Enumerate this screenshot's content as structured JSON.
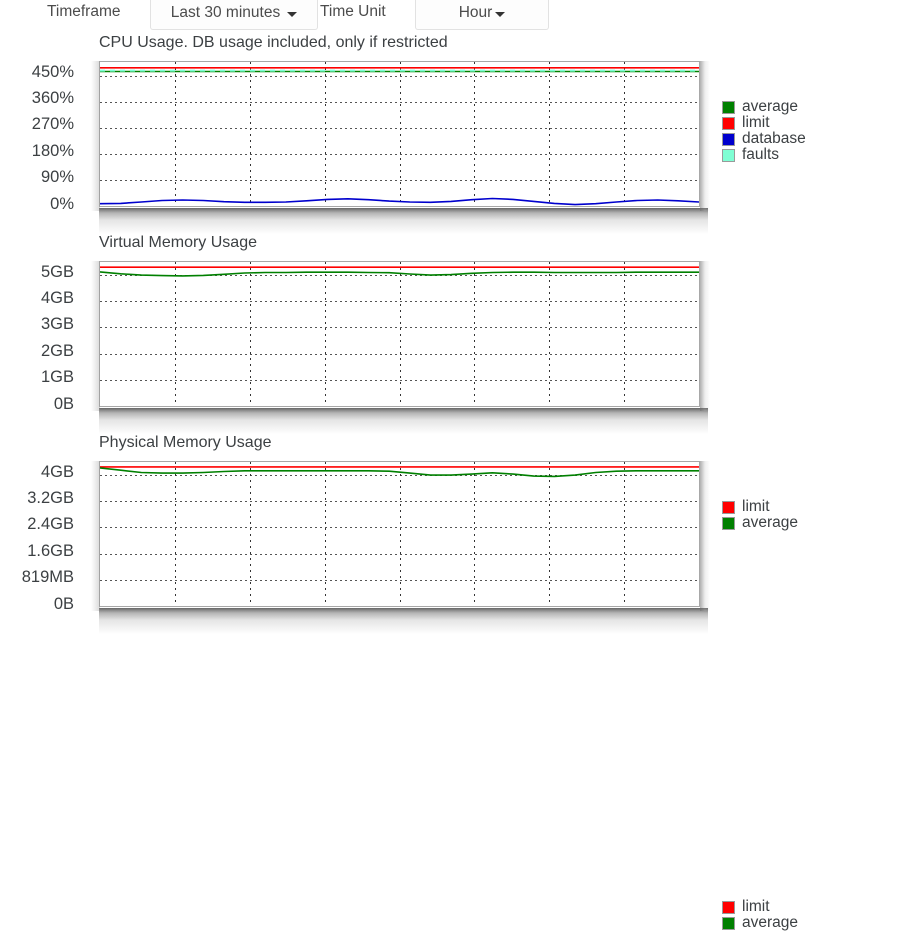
{
  "toolbar": {
    "timeframe_label": "Timeframe",
    "timeframe_value": "Last 30 minutes",
    "timeunit_label": "Time Unit",
    "timeunit_value": "Hour"
  },
  "colors": {
    "average": "#008000",
    "limit": "#ff0000",
    "database": "#0000cd",
    "faults": "#7fffd4",
    "grid": "#555555",
    "axis": "#a8a8a8",
    "text": "#3c4043"
  },
  "charts": [
    {
      "id": "cpu",
      "title": "CPU Usage. DB usage included, only if restricted",
      "yticks": [
        "450%",
        "360%",
        "270%",
        "180%",
        "90%",
        "0%"
      ],
      "legend": [
        {
          "label": "average",
          "color": "#008000"
        },
        {
          "label": "limit",
          "color": "#ff0000"
        },
        {
          "label": "database",
          "color": "#0000cd"
        },
        {
          "label": "faults",
          "color": "#7fffd4"
        }
      ]
    },
    {
      "id": "vmem",
      "title": "Virtual Memory Usage",
      "yticks": [
        "5GB",
        "4GB",
        "3GB",
        "2GB",
        "1GB",
        "0B"
      ],
      "legend": [
        {
          "label": "limit",
          "color": "#ff0000"
        },
        {
          "label": "average",
          "color": "#008000"
        }
      ]
    },
    {
      "id": "pmem",
      "title": "Physical Memory Usage",
      "yticks": [
        "4GB",
        "3.2GB",
        "2.4GB",
        "1.6GB",
        "819MB",
        "0B"
      ],
      "legend": [
        {
          "label": "limit",
          "color": "#ff0000"
        },
        {
          "label": "average",
          "color": "#008000"
        }
      ]
    }
  ],
  "chart_data": [
    {
      "type": "line",
      "title": "CPU Usage. DB usage included, only if restricted",
      "xlabel": "",
      "ylabel": "",
      "ylim": [
        0,
        500
      ],
      "ytick_values": [
        450,
        360,
        270,
        180,
        90,
        0
      ],
      "ytick_labels": [
        "450%",
        "360%",
        "270%",
        "180%",
        "90%",
        "0%"
      ],
      "grid": true,
      "legend_position": "right",
      "x": [
        0,
        1,
        2,
        3,
        4,
        5,
        6,
        7,
        8,
        9,
        10,
        11,
        12,
        13,
        14,
        15,
        16,
        17,
        18,
        19,
        20,
        21,
        22,
        23,
        24,
        25,
        26,
        27,
        28,
        29
      ],
      "series": [
        {
          "name": "limit",
          "color": "#ff0000",
          "values": [
            480,
            480,
            480,
            480,
            480,
            480,
            480,
            480,
            480,
            480,
            480,
            480,
            480,
            480,
            480,
            480,
            480,
            480,
            480,
            480,
            480,
            480,
            480,
            480,
            480,
            480,
            480,
            480,
            480,
            480
          ]
        },
        {
          "name": "average",
          "color": "#008000",
          "values": [
            467,
            467,
            467,
            467,
            467,
            467,
            467,
            467,
            467,
            467,
            467,
            467,
            467,
            467,
            467,
            467,
            467,
            467,
            467,
            467,
            467,
            467,
            467,
            467,
            467,
            467,
            467,
            467,
            467,
            467
          ]
        },
        {
          "name": "faults",
          "color": "#7fffd4",
          "values": [
            470,
            470,
            470,
            470,
            470,
            470,
            470,
            470,
            470,
            470,
            470,
            470,
            470,
            470,
            470,
            470,
            470,
            470,
            470,
            470,
            470,
            470,
            470,
            470,
            470,
            470,
            470,
            470,
            470,
            470
          ]
        },
        {
          "name": "database",
          "color": "#0000cd",
          "values": [
            8,
            9,
            14,
            19,
            21,
            19,
            15,
            13,
            13,
            14,
            18,
            23,
            25,
            22,
            17,
            14,
            13,
            16,
            22,
            26,
            23,
            16,
            9,
            5,
            8,
            14,
            19,
            21,
            18,
            14
          ]
        }
      ]
    },
    {
      "type": "line",
      "title": "Virtual Memory Usage",
      "xlabel": "",
      "ylabel": "",
      "ylim": [
        0,
        5.5
      ],
      "ytick_values": [
        5,
        4,
        3,
        2,
        1,
        0
      ],
      "ytick_labels": [
        "5GB",
        "4GB",
        "3GB",
        "2GB",
        "1GB",
        "0B"
      ],
      "grid": true,
      "legend_position": "right",
      "x": [
        0,
        1,
        2,
        3,
        4,
        5,
        6,
        7,
        8,
        9,
        10,
        11,
        12,
        13,
        14,
        15,
        16,
        17,
        18,
        19,
        20,
        21,
        22,
        23,
        24,
        25,
        26,
        27,
        28,
        29
      ],
      "series": [
        {
          "name": "limit",
          "color": "#ff0000",
          "values": [
            5.3,
            5.3,
            5.3,
            5.3,
            5.3,
            5.3,
            5.3,
            5.3,
            5.3,
            5.3,
            5.3,
            5.3,
            5.3,
            5.3,
            5.3,
            5.3,
            5.3,
            5.3,
            5.3,
            5.3,
            5.3,
            5.3,
            5.3,
            5.3,
            5.3,
            5.3,
            5.3,
            5.3,
            5.3,
            5.3
          ]
        },
        {
          "name": "average",
          "color": "#008000",
          "values": [
            5.12,
            5.05,
            5.0,
            4.98,
            4.97,
            4.99,
            5.03,
            5.08,
            5.1,
            5.1,
            5.11,
            5.11,
            5.11,
            5.1,
            5.09,
            5.04,
            5.0,
            5.02,
            5.07,
            5.1,
            5.11,
            5.11,
            5.1,
            5.1,
            5.1,
            5.1,
            5.11,
            5.11,
            5.11,
            5.11
          ]
        }
      ]
    },
    {
      "type": "line",
      "title": "Physical Memory Usage",
      "xlabel": "",
      "ylabel": "",
      "ylim": [
        0,
        4.4
      ],
      "ytick_values": [
        4,
        3.2,
        2.4,
        1.6,
        0.8,
        0
      ],
      "ytick_labels": [
        "4GB",
        "3.2GB",
        "2.4GB",
        "1.6GB",
        "819MB",
        "0B"
      ],
      "grid": true,
      "legend_position": "right",
      "x": [
        0,
        1,
        2,
        3,
        4,
        5,
        6,
        7,
        8,
        9,
        10,
        11,
        12,
        13,
        14,
        15,
        16,
        17,
        18,
        19,
        20,
        21,
        22,
        23,
        24,
        25,
        26,
        27,
        28,
        29
      ],
      "series": [
        {
          "name": "limit",
          "color": "#ff0000",
          "values": [
            4.25,
            4.25,
            4.25,
            4.25,
            4.25,
            4.25,
            4.25,
            4.25,
            4.25,
            4.25,
            4.25,
            4.25,
            4.25,
            4.25,
            4.25,
            4.25,
            4.25,
            4.25,
            4.25,
            4.25,
            4.25,
            4.25,
            4.25,
            4.25,
            4.25,
            4.25,
            4.25,
            4.25,
            4.25,
            4.25
          ]
        },
        {
          "name": "average",
          "color": "#008000",
          "values": [
            4.22,
            4.15,
            4.08,
            4.06,
            4.06,
            4.08,
            4.11,
            4.13,
            4.13,
            4.13,
            4.13,
            4.13,
            4.13,
            4.13,
            4.12,
            4.06,
            4.0,
            4.0,
            4.03,
            4.07,
            4.03,
            3.97,
            3.96,
            4.0,
            4.08,
            4.12,
            4.13,
            4.13,
            4.13,
            4.13
          ]
        }
      ]
    }
  ]
}
